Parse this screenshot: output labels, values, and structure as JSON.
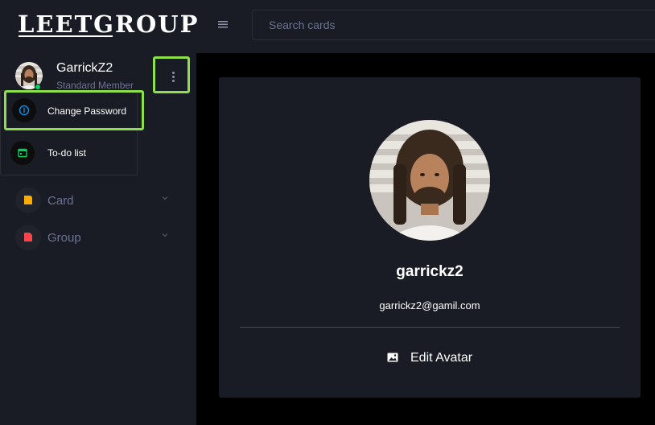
{
  "header": {
    "logo_text": "LEETGROUP",
    "menu_icon": "hamburger-icon",
    "search_placeholder": "Search cards"
  },
  "profile": {
    "name": "GarrickZ2",
    "role": "Standard Member",
    "status_color": "#00d25b",
    "more_icon": "vertical-dots-icon"
  },
  "dropdown": {
    "items": [
      {
        "label": "Change Password",
        "icon": "info-icon",
        "icon_color": "#0090e7"
      },
      {
        "label": "To-do list",
        "icon": "calendar-icon",
        "icon_color": "#00d25b"
      }
    ]
  },
  "nav": {
    "items": [
      {
        "label": "Card",
        "icon": "card-icon",
        "icon_color": "#ffab00"
      },
      {
        "label": "Group",
        "icon": "group-icon",
        "icon_color": "#fc424a"
      }
    ]
  },
  "main": {
    "username": "garrickz2",
    "email": "garrickz2@gamil.com",
    "edit_avatar_label": "Edit Avatar",
    "edit_avatar_icon": "image-icon"
  },
  "colors": {
    "accent_highlight": "#8ee04a",
    "panel": "#191c24",
    "background": "#000000",
    "muted_text": "#6c7293"
  }
}
